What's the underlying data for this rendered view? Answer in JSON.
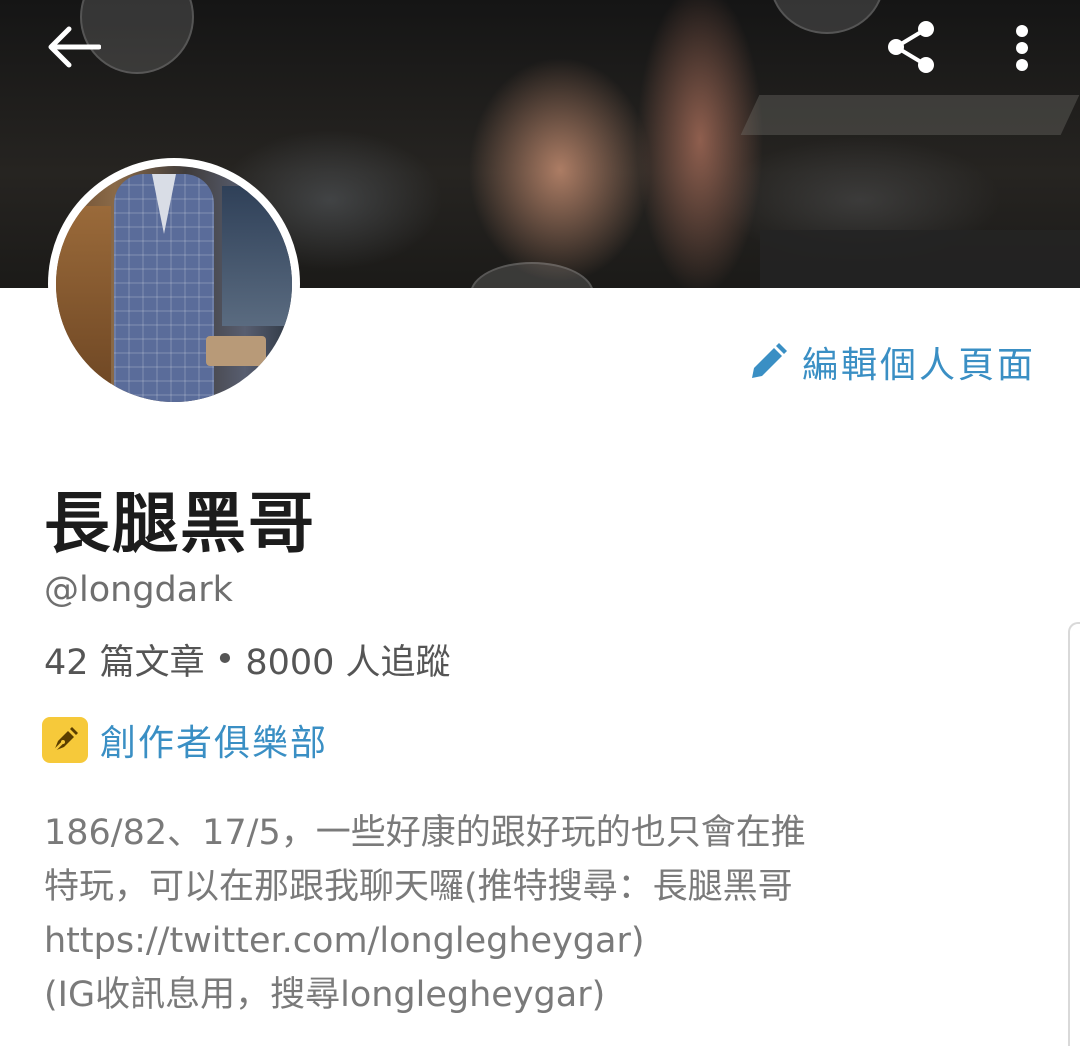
{
  "header": {
    "back_icon": "arrow-left-icon",
    "share_icon": "share-icon",
    "more_icon": "more-vertical-icon"
  },
  "profile": {
    "name": "長腿黑哥",
    "handle": "@longdark",
    "post_count": "42 篇文章",
    "separator": "•",
    "follower_count": "8000 人追蹤",
    "edit_label": "編輯個人頁面",
    "club_label": "創作者俱樂部"
  },
  "bio": {
    "lines": [
      "186/82、17/5，一些好康的跟好玩的也只會在推",
      "特玩，可以在那跟我聊天囉(推特搜尋：長腿黑哥",
      "https://twitter.com/longlegheygar)",
      "(IG收訊息用，搜尋longlegheygar)"
    ]
  },
  "colors": {
    "accent": "#3a8fc4",
    "club_badge": "#f6c93a",
    "name_text": "#1c1c1c",
    "secondary_text": "#6f6f6f"
  }
}
